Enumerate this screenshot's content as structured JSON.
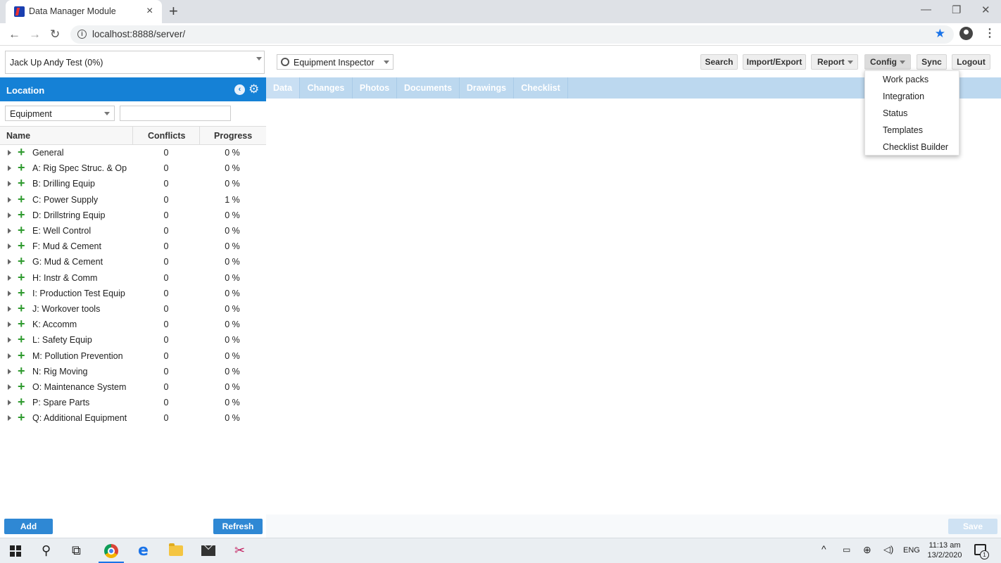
{
  "browser": {
    "tab_title": "Data Manager Module",
    "close_glyph": "×",
    "newtab_glyph": "+",
    "url": "localhost:8888/server/"
  },
  "project_selector": {
    "value": "Jack Up Andy Test (0%)"
  },
  "left_panel": {
    "title": "Location",
    "filter_value": "Equipment",
    "filter_text": "",
    "columns": [
      "Name",
      "Conflicts",
      "Progress"
    ],
    "rows": [
      {
        "name": "General",
        "conflicts": "0",
        "progress": "0 %"
      },
      {
        "name": "A: Rig Spec Struc. & Op",
        "conflicts": "0",
        "progress": "0 %"
      },
      {
        "name": "B: Drilling Equip",
        "conflicts": "0",
        "progress": "0 %"
      },
      {
        "name": "C: Power Supply",
        "conflicts": "0",
        "progress": "1 %"
      },
      {
        "name": "D: Drillstring Equip",
        "conflicts": "0",
        "progress": "0 %"
      },
      {
        "name": "E: Well Control",
        "conflicts": "0",
        "progress": "0 %"
      },
      {
        "name": "F: Mud & Cement",
        "conflicts": "0",
        "progress": "0 %"
      },
      {
        "name": "G: Mud & Cement",
        "conflicts": "0",
        "progress": "0 %"
      },
      {
        "name": "H: Instr & Comm",
        "conflicts": "0",
        "progress": "0 %"
      },
      {
        "name": "I: Production Test Equip",
        "conflicts": "0",
        "progress": "0 %"
      },
      {
        "name": "J: Workover tools",
        "conflicts": "0",
        "progress": "0 %"
      },
      {
        "name": "K: Accomm",
        "conflicts": "0",
        "progress": "0 %"
      },
      {
        "name": "L: Safety Equip",
        "conflicts": "0",
        "progress": "0 %"
      },
      {
        "name": "M: Pollution Prevention",
        "conflicts": "0",
        "progress": "0 %"
      },
      {
        "name": "N: Rig Moving",
        "conflicts": "0",
        "progress": "0 %"
      },
      {
        "name": "O: Maintenance System",
        "conflicts": "0",
        "progress": "0 %"
      },
      {
        "name": "P: Spare Parts",
        "conflicts": "0",
        "progress": "0 %"
      },
      {
        "name": "Q: Additional Equipment",
        "conflicts": "0",
        "progress": "0 %"
      }
    ],
    "add_label": "Add",
    "refresh_label": "Refresh"
  },
  "toolbar": {
    "inspector_value": "Equipment Inspector",
    "search_label": "Search",
    "import_export_label": "Import/Export",
    "report_label": "Report",
    "config_label": "Config",
    "sync_label": "Sync",
    "logout_label": "Logout"
  },
  "tabs": [
    "Data",
    "Changes",
    "Photos",
    "Documents",
    "Drawings",
    "Checklist"
  ],
  "config_menu": [
    "Work packs",
    "Integration",
    "Status",
    "Templates",
    "Checklist Builder"
  ],
  "save_label": "Save",
  "taskbar": {
    "lang": "ENG",
    "time": "11:13 am",
    "date": "13/2/2020",
    "notification_count": "1"
  },
  "colors": {
    "header_blue": "#1581d6",
    "button_blue": "#2f88d4",
    "tab_strip": "#bcd8ef",
    "plus_green": "#2e9a2e"
  }
}
